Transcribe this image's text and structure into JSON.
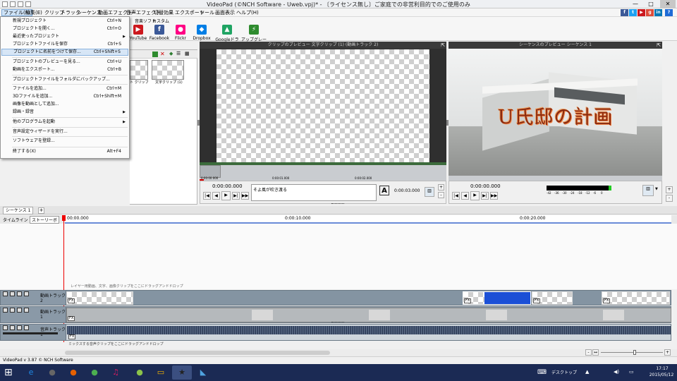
{
  "window": {
    "title": "VideoPad (©NCH Software - Uweb.vpj)* - 〔ライセンス無し〕ご家庭での非営利目的でのご使用のみ",
    "minimize": "—",
    "maximize": "□",
    "close": "✕"
  },
  "menu": [
    "ファイル(F)",
    "編集(E)",
    "クリップ",
    "トラック",
    "シーケンス",
    "動画エフェクト",
    "音声エフェクト",
    "切替効果",
    "エクスポート",
    "ツール",
    "画面表示",
    "ヘルプ(H)"
  ],
  "social": [
    {
      "icon": "facebook-icon",
      "glyph": "f",
      "color": "#3b5998"
    },
    {
      "icon": "twitter-icon",
      "glyph": "t",
      "color": "#1da1f2"
    },
    {
      "icon": "youtube-icon",
      "glyph": "▶",
      "color": "#cc181e"
    },
    {
      "icon": "googleplus-icon",
      "glyph": "g",
      "color": "#dd4b39"
    },
    {
      "icon": "linkedin-icon",
      "glyph": "in",
      "color": "#0077b5"
    }
  ],
  "toolbar": {
    "bundle": "音楽ソフト",
    "custom": "カスタム",
    "items": [
      {
        "label": "YouTube",
        "icon": "youtube-icon",
        "color": "#cc181e",
        "glyph": "▶"
      },
      {
        "label": "Facebook",
        "icon": "facebook-icon",
        "color": "#3b5998",
        "glyph": "f"
      },
      {
        "label": "Flickr",
        "icon": "flickr-icon",
        "color": "#ff0084",
        "glyph": "●"
      },
      {
        "label": "Dropbox",
        "icon": "dropbox-icon",
        "color": "#007ee5",
        "glyph": "◆"
      },
      {
        "label": "Googleドライブ",
        "icon": "google-drive-icon",
        "color": "#1fa463",
        "glyph": "▲"
      },
      {
        "label": "アップグレード",
        "icon": "upgrade-icon",
        "color": "#2e8b2e",
        "glyph": "⚡"
      }
    ]
  },
  "file_menu": {
    "items": [
      {
        "label": "新規プロジェクト",
        "shortcut": "Ctrl+N"
      },
      {
        "label": "プロジェクトを開く...",
        "shortcut": "Ctrl+O"
      },
      {
        "label": "最近使ったプロジェクト",
        "shortcut": "",
        "submenu": true
      },
      {
        "label": "プロジェクトファイルを保存",
        "shortcut": "Ctrl+S"
      },
      {
        "label": "プロジェクトに名前をつけて保存...",
        "shortcut": "Ctrl+Shift+S",
        "highlighted": true
      },
      {
        "label": "プロジェクトのプレビューを見る...",
        "shortcut": "Ctrl+U"
      },
      {
        "label": "動画をエクスポート...",
        "shortcut": "Ctrl+B"
      },
      {
        "label": "プロジェクトファイルをフォルダにバックアップ...",
        "shortcut": ""
      },
      {
        "label": "ファイルを追加...",
        "shortcut": "Ctrl+M"
      },
      {
        "label": "3Dファイルを追加...",
        "shortcut": "Ctrl+Shift+M"
      },
      {
        "label": "画像を動画として追加...",
        "shortcut": ""
      },
      {
        "label": "録画・録音",
        "shortcut": "",
        "submenu": true
      },
      {
        "label": "他のプログラムを起動",
        "shortcut": "",
        "submenu": true
      },
      {
        "label": "音声設定ウィザードを実行...",
        "shortcut": ""
      },
      {
        "label": "ソフトウェアを登録...",
        "shortcut": ""
      },
      {
        "label": "終了する(X)",
        "shortcut": "Alt+F4"
      }
    ]
  },
  "media_bin": {
    "clips": [
      "ト クリップ (2)",
      "文字クリップ (1)"
    ]
  },
  "clip_preview": {
    "title": "クリップのプレビュー  文字クリップ (1) (動画トラック 2)",
    "time": "0:00:00.000",
    "text_value": "そよ風が吹き渡る",
    "duration": "0:00:03.000",
    "ruler": [
      "0:00:00.000",
      "0:00:01.000",
      "0:00:02.000"
    ]
  },
  "seq_preview": {
    "title": "シーケンスのプレビュー  シーケンス 1",
    "time": "0:00:00.000",
    "overlay_text": "U氏邸の計画",
    "meter": [
      "-42",
      "-36",
      "-30",
      "-24",
      "-18",
      "-12",
      "-6",
      "0"
    ]
  },
  "timeline": {
    "tab": "シーケンス 1",
    "add_tab": "+",
    "view_tabs": [
      "タイムライン",
      "ストーリーボ"
    ],
    "ruler": [
      "00:00.000",
      "0:00:10.000",
      "0:00:20.000"
    ],
    "layer_hint": "レイヤー用動画、文字、画像クリップをここにドラッグアンドドロップ",
    "audio_hint": "ミックスする音声クリップをここにドラッグアンドドロップ",
    "tracks": [
      "動画トラック 2",
      "動画トラック 1",
      "音声トラック 1"
    ]
  },
  "statusbar": "VideoPad v 3.87 © NCH Software",
  "taskbar": {
    "desktop": "デスクトップ",
    "time": "17:17",
    "date": "2015/05/12",
    "apps": [
      {
        "icon": "ie-icon",
        "glyph": "e",
        "color": "#1e88e5"
      },
      {
        "icon": "app-icon",
        "glyph": "●",
        "color": "#666"
      },
      {
        "icon": "firefox-icon",
        "glyph": "●",
        "color": "#e66000"
      },
      {
        "icon": "chrome-icon",
        "glyph": "●",
        "color": "#4caf50"
      },
      {
        "icon": "itunes-icon",
        "glyph": "♫",
        "color": "#d81b60"
      },
      {
        "icon": "app-icon",
        "glyph": "●",
        "color": "#8bc34a"
      },
      {
        "icon": "explorer-icon",
        "glyph": "▭",
        "color": "#f5b400"
      },
      {
        "icon": "videopad-icon",
        "glyph": "★",
        "color": "#222"
      },
      {
        "icon": "app-icon",
        "glyph": "◣",
        "color": "#4fa3e0"
      }
    ]
  }
}
